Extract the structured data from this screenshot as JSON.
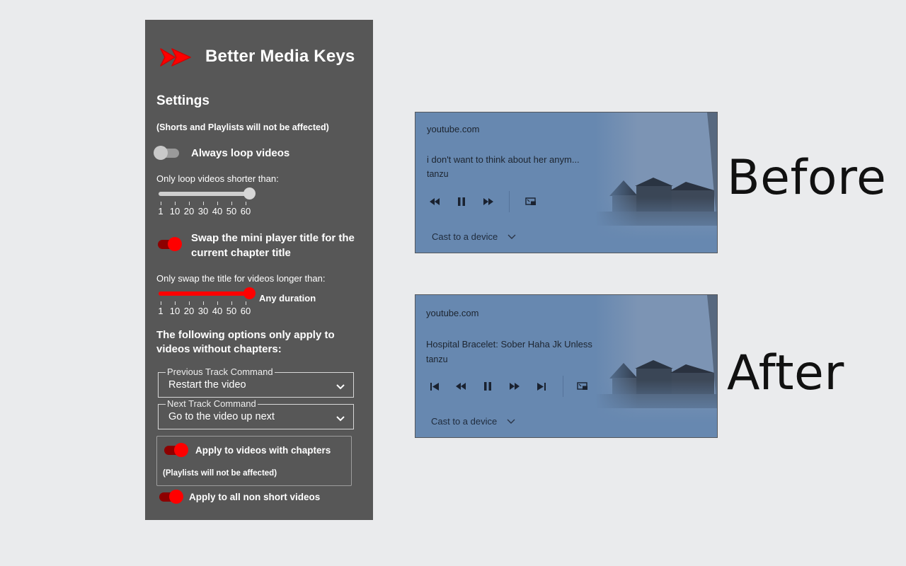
{
  "colors": {
    "panel_bg": "#575757",
    "accent_red": "#ff0000",
    "player_bg": "#6788b0",
    "page_bg": "#eaebed"
  },
  "settings_panel": {
    "app_title": "Better Media Keys",
    "logo_icon": "fast-forward-double-arrow-icon",
    "section_title": "Settings",
    "shorts_note": "(Shorts and Playlists will not be affected)",
    "loop_toggle": {
      "label": "Always loop videos",
      "on": false
    },
    "loop_slider": {
      "label": "Only loop videos shorter than:",
      "ticks": [
        "1",
        "10",
        "20",
        "30",
        "40",
        "50",
        "60"
      ],
      "value": "60"
    },
    "swap_toggle": {
      "label_line1": "Swap the mini player title for the",
      "label_line2": "current chapter title",
      "on": true
    },
    "swap_slider": {
      "label": "Only swap the title for videos longer than:",
      "ticks": [
        "1",
        "10",
        "20",
        "30",
        "40",
        "50",
        "60"
      ],
      "value": "60",
      "value_label": "Any duration"
    },
    "chapters_heading_line1": "The following options only apply to",
    "chapters_heading_line2": "videos without chapters:",
    "prev_track": {
      "legend": "Previous Track Command",
      "value": "Restart the video"
    },
    "next_track": {
      "legend": "Next Track Command",
      "value": "Go to the video up next"
    },
    "chapters_toggle": {
      "label": "Apply to videos with chapters",
      "on": true,
      "note": "(Playlists will not be affected)"
    },
    "non_short_toggle": {
      "label": "Apply to all non short videos",
      "on": true
    }
  },
  "before_player": {
    "site": "youtube.com",
    "title": "i don't want to think about her anym...",
    "artist": "tanzu",
    "cast_label": "Cast to a device",
    "controls": [
      "rewind-icon",
      "pause-icon",
      "fast-forward-icon",
      "miniplayer-icon"
    ]
  },
  "after_player": {
    "site": "youtube.com",
    "title": "Hospital Bracelet: Sober Haha Jk Unless",
    "artist": "tanzu",
    "cast_label": "Cast to a device",
    "controls": [
      "previous-track-icon",
      "rewind-icon",
      "pause-icon",
      "fast-forward-icon",
      "next-track-icon",
      "miniplayer-icon"
    ]
  },
  "captions": {
    "before": "Before",
    "after": "After"
  }
}
